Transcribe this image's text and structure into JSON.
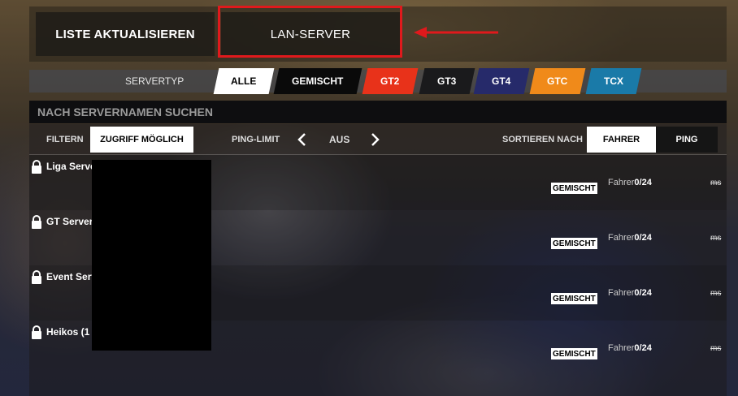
{
  "header": {
    "refresh_label": "LISTE AKTUALISIEREN",
    "lan_label": "LAN-SERVER"
  },
  "server_type": {
    "label": "SERVERTYP",
    "tabs": [
      {
        "label": "ALLE",
        "bg": "#ffffff",
        "fg": "#000000"
      },
      {
        "label": "GEMISCHT",
        "bg": "#0a0a0a",
        "fg": "#ffffff"
      },
      {
        "label": "GT2",
        "bg": "#e8321a",
        "fg": "#ffffff"
      },
      {
        "label": "GT3",
        "bg": "#1a1a1c",
        "fg": "#ffffff"
      },
      {
        "label": "GT4",
        "bg": "#262a6a",
        "fg": "#ffffff"
      },
      {
        "label": "GTC",
        "bg": "#f08a1a",
        "fg": "#ffffff"
      },
      {
        "label": "TCX",
        "bg": "#1a7aa8",
        "fg": "#ffffff"
      }
    ]
  },
  "search": {
    "placeholder": "NACH SERVERNAMEN SUCHEN"
  },
  "filter": {
    "filter_label": "FILTERN",
    "access_label": "ZUGRIFF MÖGLICH",
    "ping_label": "PING-LIMIT",
    "ping_value": "AUS",
    "sort_label": "SORTIEREN NACH",
    "sort_driver": "FAHRER",
    "sort_ping": "PING"
  },
  "servers": [
    {
      "name": "Liga Serve",
      "type": "GEMISCHT",
      "drivers_label": "Fahrer",
      "drivers": "0/24",
      "ping": "ms"
    },
    {
      "name": "GT Server",
      "type": "GEMISCHT",
      "drivers_label": "Fahrer",
      "drivers": "0/24",
      "ping": "ms"
    },
    {
      "name": "Event Serv",
      "type": "GEMISCHT",
      "drivers_label": "Fahrer",
      "drivers": "0/24",
      "ping": "ms"
    },
    {
      "name": "Heikos (1",
      "type": "GEMISCHT",
      "drivers_label": "Fahrer",
      "drivers": "0/24",
      "ping": "ms"
    }
  ],
  "colors": {
    "highlight": "#e0191c"
  },
  "icons": [
    "lock-icon",
    "chevron-left-icon",
    "chevron-right-icon",
    "arrow-left-icon"
  ]
}
